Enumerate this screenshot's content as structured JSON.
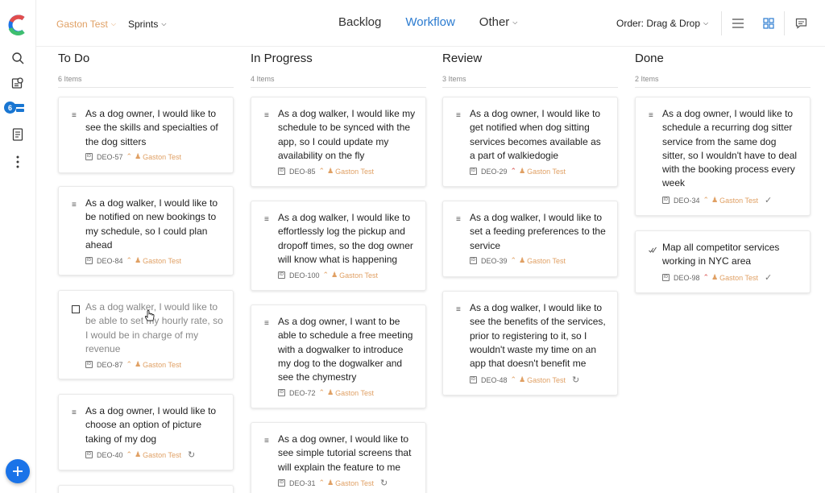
{
  "rail": {
    "notifications_badge": "6"
  },
  "topbar": {
    "project": "Gaston Test",
    "sprints": "Sprints",
    "tabs": [
      "Backlog",
      "Workflow",
      "Other"
    ],
    "active_tab": "Workflow",
    "order": "Order: Drag & Drop"
  },
  "colors": {
    "accent": "#2b7bd0",
    "assignee": "#e0a064",
    "high_priority": "#d9534f",
    "fab": "#1a73e8"
  },
  "columns": [
    {
      "title": "To Do",
      "count": "6 Items",
      "cards": [
        {
          "title": "As a dog owner, I would like to see the skills and specialties of the dog sitters",
          "id": "DEO-57",
          "assignee": "Gaston Test",
          "priority": "medium",
          "icon": "story-icon"
        },
        {
          "title": "As a dog walker, I would like to be notified on new bookings to my schedule, so I could plan ahead",
          "id": "DEO-84",
          "assignee": "Gaston Test",
          "priority": "medium",
          "icon": "story-icon"
        },
        {
          "title": "As a dog walker, I would like to be able to set my hourly rate, so I would be in charge of my revenue",
          "id": "DEO-87",
          "assignee": "Gaston Test",
          "priority": "medium",
          "icon": "checkbox-icon"
        },
        {
          "title": "As a dog owner, I would like to choose an option of picture taking of my dog",
          "id": "DEO-40",
          "assignee": "Gaston Test",
          "priority": "medium",
          "icon": "story-icon",
          "status": "refresh-icon"
        }
      ]
    },
    {
      "title": "In Progress",
      "count": "4 Items",
      "cards": [
        {
          "title": "As a dog walker, I would like my schedule to be synced with the app, so I could update my availability on the fly",
          "id": "DEO-85",
          "assignee": "Gaston Test",
          "priority": "medium",
          "icon": "story-icon"
        },
        {
          "title": "As a dog walker, I would like to effortlessly log the pickup and dropoff times, so the dog owner will know what is happening",
          "id": "DEO-100",
          "assignee": "Gaston Test",
          "priority": "medium",
          "icon": "story-icon"
        },
        {
          "title": "As a dog owner, I want to be able to schedule a free meeting with a dogwalker to introduce my dog to the dogwalker and see the chymestry",
          "id": "DEO-72",
          "assignee": "Gaston Test",
          "priority": "medium",
          "icon": "story-icon"
        },
        {
          "title": "As a dog owner, I would like to see simple tutorial screens that will explain the feature to me",
          "id": "DEO-31",
          "assignee": "Gaston Test",
          "priority": "medium",
          "icon": "story-icon",
          "status": "refresh-icon"
        }
      ]
    },
    {
      "title": "Review",
      "count": "3 Items",
      "cards": [
        {
          "title": "As a dog owner, I would like to get notified when dog sitting services becomes available as a part of walkiedogie",
          "id": "DEO-29",
          "assignee": "Gaston Test",
          "priority": "high",
          "icon": "story-icon"
        },
        {
          "title": "As a dog walker, I would like to set a feeding preferences to the service",
          "id": "DEO-39",
          "assignee": "Gaston Test",
          "priority": "medium",
          "icon": "story-icon"
        },
        {
          "title": "As a dog walker, I would like to see the benefits of the services, prior to registering to it, so I wouldn't waste my time on an app that doesn't benefit me",
          "id": "DEO-48",
          "assignee": "Gaston Test",
          "priority": "medium",
          "icon": "story-icon",
          "status": "refresh-icon"
        }
      ]
    },
    {
      "title": "Done",
      "count": "2 Items",
      "cards": [
        {
          "title": "As a dog owner, I would like to schedule a recurring dog sitter service from the same dog sitter, so I wouldn't have to deal with the booking process every week",
          "id": "DEO-34",
          "assignee": "Gaston Test",
          "priority": "medium",
          "icon": "story-icon",
          "status": "check-icon"
        },
        {
          "title": "Map all competitor services working in NYC area",
          "id": "DEO-98",
          "assignee": "Gaston Test",
          "priority": "high",
          "icon": "task-icon",
          "status": "check-icon"
        }
      ]
    }
  ]
}
